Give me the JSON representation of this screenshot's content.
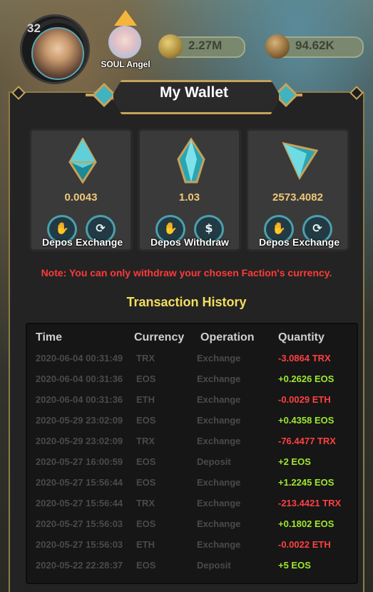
{
  "hud": {
    "level": "32",
    "player_name": "SOUL Angel",
    "gold": "2.27M",
    "resource": "94.62K"
  },
  "wallet": {
    "title": "My Wallet",
    "cards": [
      {
        "currency_icon": "eth-diamond-icon",
        "amount": "0.0043",
        "buttons": [
          "Depos",
          "Exchange"
        ]
      },
      {
        "currency_icon": "eos-crystal-icon",
        "amount": "1.03",
        "buttons": [
          "Depos",
          "Withdraw"
        ]
      },
      {
        "currency_icon": "trx-triangle-icon",
        "amount": "2573.4082",
        "buttons": [
          "Depos",
          "Exchange"
        ]
      }
    ],
    "note": "Note: You can only withdraw your chosen Faction's currency.",
    "history_title": "Transaction History"
  },
  "table": {
    "headers": [
      "Time",
      "Currency",
      "Operation",
      "Quantity"
    ],
    "rows": [
      {
        "time": "2020-06-04 00:31:49",
        "currency": "TRX",
        "operation": "Exchange",
        "quantity": "-3.0864 TRX"
      },
      {
        "time": "2020-06-04 00:31:36",
        "currency": "EOS",
        "operation": "Exchange",
        "quantity": "+0.2626 EOS"
      },
      {
        "time": "2020-06-04 00:31:36",
        "currency": "ETH",
        "operation": "Exchange",
        "quantity": "-0.0029 ETH"
      },
      {
        "time": "2020-05-29 23:02:09",
        "currency": "EOS",
        "operation": "Exchange",
        "quantity": "+0.4358 EOS"
      },
      {
        "time": "2020-05-29 23:02:09",
        "currency": "TRX",
        "operation": "Exchange",
        "quantity": "-76.4477 TRX"
      },
      {
        "time": "2020-05-27 16:00:59",
        "currency": "EOS",
        "operation": "Deposit",
        "quantity": "+2 EOS"
      },
      {
        "time": "2020-05-27 15:56:44",
        "currency": "EOS",
        "operation": "Exchange",
        "quantity": "+1.2245 EOS"
      },
      {
        "time": "2020-05-27 15:56:44",
        "currency": "TRX",
        "operation": "Exchange",
        "quantity": "-213.4421 TRX"
      },
      {
        "time": "2020-05-27 15:56:03",
        "currency": "EOS",
        "operation": "Exchange",
        "quantity": "+0.1802 EOS"
      },
      {
        "time": "2020-05-27 15:56:03",
        "currency": "ETH",
        "operation": "Exchange",
        "quantity": "-0.0022 ETH"
      },
      {
        "time": "2020-05-22 22:28:37",
        "currency": "EOS",
        "operation": "Deposit",
        "quantity": "+5 EOS"
      }
    ]
  },
  "colors": {
    "positive": "#9ee830",
    "negative": "#ff4040",
    "accent": "#4aa1ad",
    "gold": "#c6a25a"
  }
}
